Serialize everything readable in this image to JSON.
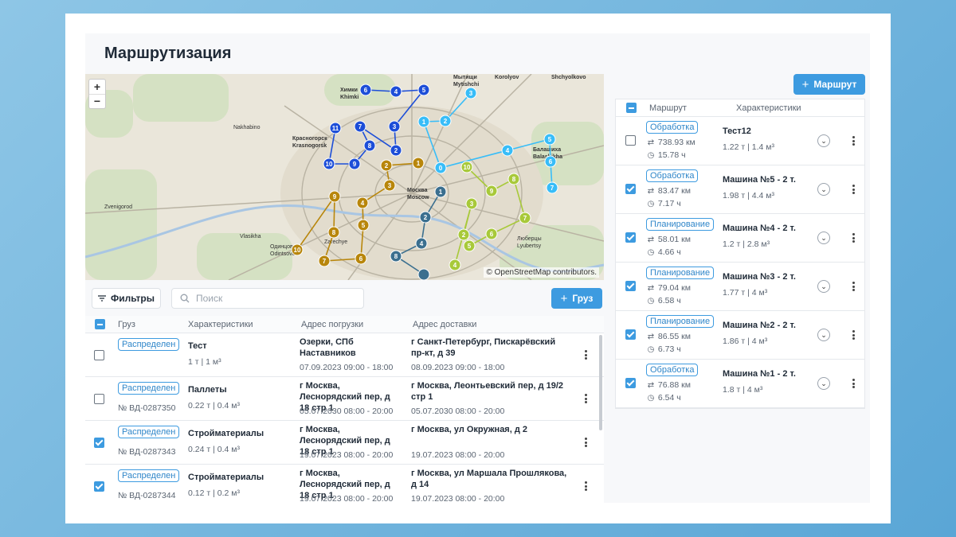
{
  "page": {
    "title": "Маршрутизация"
  },
  "map": {
    "zoom_in": "+",
    "zoom_out": "−",
    "attribution": "© OpenStreetMap contributors.",
    "labels": [
      "Химки",
      "Khimki",
      "Мытищи",
      "Mytishchi",
      "Korolyov",
      "Shchyolkovo",
      "Красногорск",
      "Krasnogorsk",
      "Москва",
      "Moscow",
      "Балашиха",
      "Balashikha",
      "Одинцово",
      "Odintsovo",
      "Люберцы",
      "Lyubertsy",
      "Zarechye",
      "Nakhabino",
      "Zvenigorod",
      "Vlasikha"
    ],
    "route_colors": [
      "#1d4ed8",
      "#38bdf8",
      "#3b6f8f",
      "#b8860b",
      "#c58a1a",
      "#a8c93a"
    ]
  },
  "toolbar": {
    "filters_label": "Фильтры",
    "search_placeholder": "Поиск",
    "cargo_button": "Груз",
    "route_button": "Маршрут"
  },
  "cargo_table": {
    "headers": {
      "cargo": "Груз",
      "characteristics": "Характеристики",
      "pickup": "Адрес погрузки",
      "delivery": "Адрес доставки"
    },
    "rows": [
      {
        "checked": false,
        "status": "Распределен",
        "code": "",
        "name": "Тест",
        "metrics": "1 т | 1 м³",
        "pickup_address": "Озерки, СПб Наставников",
        "pickup_time": "07.09.2023 09:00 - 18:00",
        "delivery_address": "г Санкт-Петербург, Пискарёвский пр-кт, д 39",
        "delivery_time": "08.09.2023 09:00 - 18:00"
      },
      {
        "checked": false,
        "status": "Распределен",
        "code": "№ ВД-0287350",
        "name": "Паллеты",
        "metrics": "0.22 т | 0.4 м³",
        "pickup_address": "г Москва, Леснорядский пер, д 18 стр 1",
        "pickup_time": "05.07.2030 08:00 - 20:00",
        "delivery_address": "г Москва, Леонтьевский пер, д 19/2 стр 1",
        "delivery_time": "05.07.2030 08:00 - 20:00"
      },
      {
        "checked": true,
        "status": "Распределен",
        "code": "№ ВД-0287343",
        "name": "Стройматериалы",
        "metrics": "0.24 т | 0.4 м³",
        "pickup_address": "г Москва, Леснорядский пер, д 18 стр 1",
        "pickup_time": "19.07.2023 08:00 - 20:00",
        "delivery_address": "г Москва, ул Окружная, д 2",
        "delivery_time": "19.07.2023 08:00 - 20:00"
      },
      {
        "checked": true,
        "status": "Распределен",
        "code": "№ ВД-0287344",
        "name": "Стройматериалы",
        "metrics": "0.12 т | 0.2 м³",
        "pickup_address": "г Москва, Леснорядский пер, д 18 стр 1",
        "pickup_time": "19.07.2023 08:00 - 20:00",
        "delivery_address": "г Москва, ул Маршала Прошлякова, д 14",
        "delivery_time": "19.07.2023 08:00 - 20:00"
      }
    ]
  },
  "routes_table": {
    "headers": {
      "route": "Маршрут",
      "characteristics": "Характеристики"
    },
    "rows": [
      {
        "checked": false,
        "status": "Обработка",
        "distance": "738.93 км",
        "duration": "15.78 ч",
        "vehicle": "Тест12",
        "metrics": "1.22 т | 1.4 м³"
      },
      {
        "checked": true,
        "status": "Обработка",
        "distance": "83.47 км",
        "duration": "7.17 ч",
        "vehicle": "Машина №5 - 2 т.",
        "metrics": "1.98 т | 4.4 м³"
      },
      {
        "checked": true,
        "status": "Планирование",
        "distance": "58.01 км",
        "duration": "4.66 ч",
        "vehicle": "Машина №4 - 2 т.",
        "metrics": "1.2 т | 2.8 м³"
      },
      {
        "checked": true,
        "status": "Планирование",
        "distance": "79.04 км",
        "duration": "6.58 ч",
        "vehicle": "Машина №3 - 2 т.",
        "metrics": "1.77 т | 4 м³"
      },
      {
        "checked": true,
        "status": "Планирование",
        "distance": "86.55 км",
        "duration": "6.73 ч",
        "vehicle": "Машина №2 - 2 т.",
        "metrics": "1.86 т | 4 м³"
      },
      {
        "checked": true,
        "status": "Обработка",
        "distance": "76.88 км",
        "duration": "6.54 ч",
        "vehicle": "Машина №1 - 2 т.",
        "metrics": "1.8 т | 4 м³"
      }
    ]
  }
}
